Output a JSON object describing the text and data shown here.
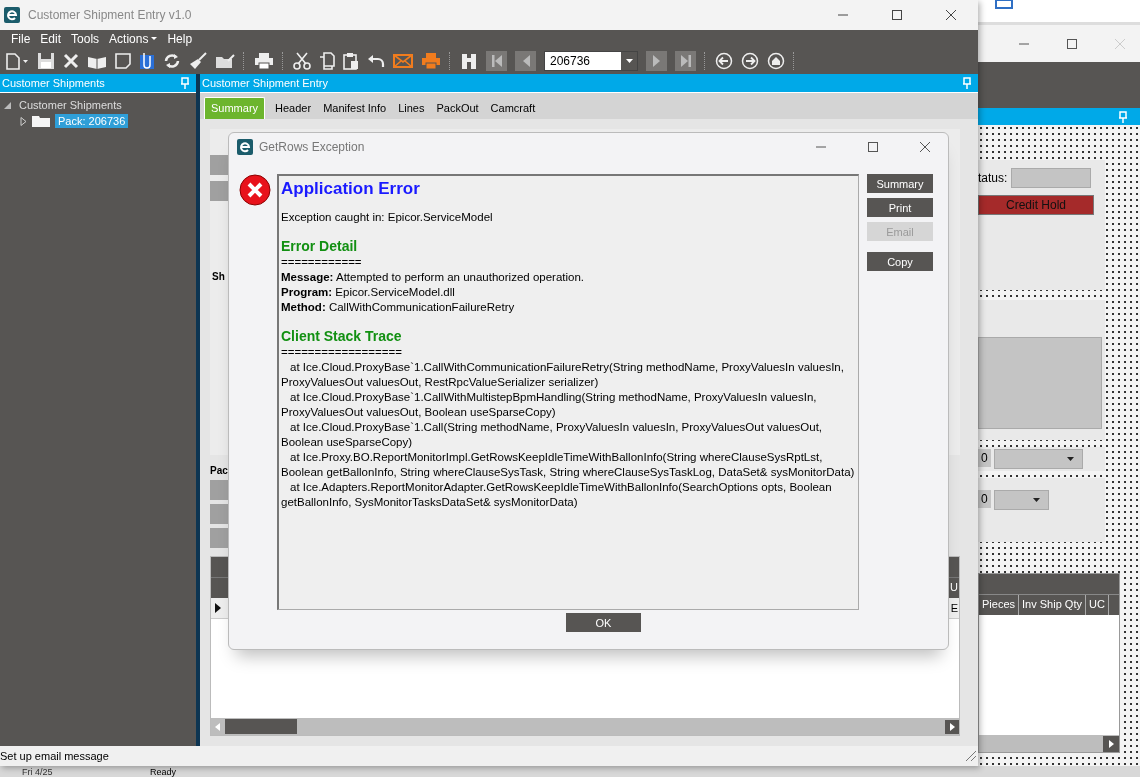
{
  "main_window": {
    "title": "Customer Shipment Entry v1.0"
  },
  "menu": [
    {
      "label": "File",
      "dropdown": false
    },
    {
      "label": "Edit",
      "dropdown": false
    },
    {
      "label": "Tools",
      "dropdown": false
    },
    {
      "label": "Actions",
      "dropdown": true
    },
    {
      "label": "Help",
      "dropdown": false
    }
  ],
  "toolbar": {
    "record": "206736"
  },
  "tree_panel": {
    "title": "Customer Shipments",
    "items": [
      {
        "label": "Customer Shipments",
        "expanded": true,
        "selected": false,
        "children": [
          {
            "label": "Pack: 206736",
            "expanded": false,
            "selected": true
          }
        ]
      }
    ]
  },
  "entry_panel": {
    "title": "Customer Shipment Entry",
    "tabs": [
      {
        "label": "Summary",
        "selected": true
      },
      {
        "label": "Header",
        "selected": false
      },
      {
        "label": "Manifest Info",
        "selected": false
      },
      {
        "label": "Lines",
        "selected": false
      },
      {
        "label": "PackOut",
        "selected": false
      },
      {
        "label": "Camcraft",
        "selected": false
      }
    ],
    "labels": [
      "Sh",
      "Pac"
    ],
    "grid_header": "U",
    "grid_cell": "E"
  },
  "status_bar": {
    "text": "Set up email message"
  },
  "background_window": {
    "status_label": "tatus:",
    "credit_hold": "Credit Hold",
    "values": [
      "0",
      "0"
    ],
    "columns": [
      "Pieces",
      "Inv Ship Qty",
      "UC"
    ]
  },
  "taskbar": {
    "date": "Fri 4/25",
    "status": "Ready"
  },
  "dialog": {
    "title": "GetRows Exception",
    "content": [
      {
        "kind": "title",
        "text": "Application Error"
      },
      {
        "kind": "line",
        "text": "Exception caught in: Epicor.ServiceModel"
      },
      {
        "kind": "section",
        "text": "Error Detail"
      },
      {
        "kind": "line",
        "text": "============"
      },
      {
        "kind": "line",
        "text": "**Message:** Attempted to perform an unauthorized operation."
      },
      {
        "kind": "line",
        "text": "**Program:** Epicor.ServiceModel.dll"
      },
      {
        "kind": "line",
        "text": "**Method:** CallWithCommunicationFailureRetry"
      },
      {
        "kind": "section",
        "text": "Client Stack Trace"
      },
      {
        "kind": "line",
        "text": "=================="
      },
      {
        "kind": "trace",
        "text": "at Ice.Cloud.ProxyBase`1.CallWithCommunicationFailureRetry(String methodName, ProxyValuesIn valuesIn, ProxyValuesOut valuesOut, RestRpcValueSerializer serializer)"
      },
      {
        "kind": "trace",
        "text": "at Ice.Cloud.ProxyBase`1.CallWithMultistepBpmHandling(String methodName, ProxyValuesIn valuesIn, ProxyValuesOut valuesOut, Boolean useSparseCopy)"
      },
      {
        "kind": "trace",
        "text": "at Ice.Cloud.ProxyBase`1.Call(String methodName, ProxyValuesIn valuesIn, ProxyValuesOut valuesOut, Boolean useSparseCopy)"
      },
      {
        "kind": "trace",
        "text": "at Ice.Proxy.BO.ReportMonitorImpl.GetRowsKeepIdleTimeWithBallonInfo(String whereClauseSysRptLst, Boolean getBallonInfo, String whereClauseSysTask, String whereClauseSysTaskLog, DataSet& sysMonitorData)"
      },
      {
        "kind": "trace",
        "text": "at Ice.Adapters.ReportMonitorAdapter.GetRowsKeepIdleTimeWithBallonInfo(SearchOptions opts, Boolean getBallonInfo, SysMonitorTasksDataSet& sysMonitorData)"
      }
    ],
    "buttons": [
      {
        "label": "Summary",
        "disabled": false
      },
      {
        "label": "Print",
        "disabled": false
      },
      {
        "label": "Email",
        "disabled": true
      },
      {
        "label": "Copy",
        "disabled": false
      }
    ],
    "ok": "OK"
  }
}
